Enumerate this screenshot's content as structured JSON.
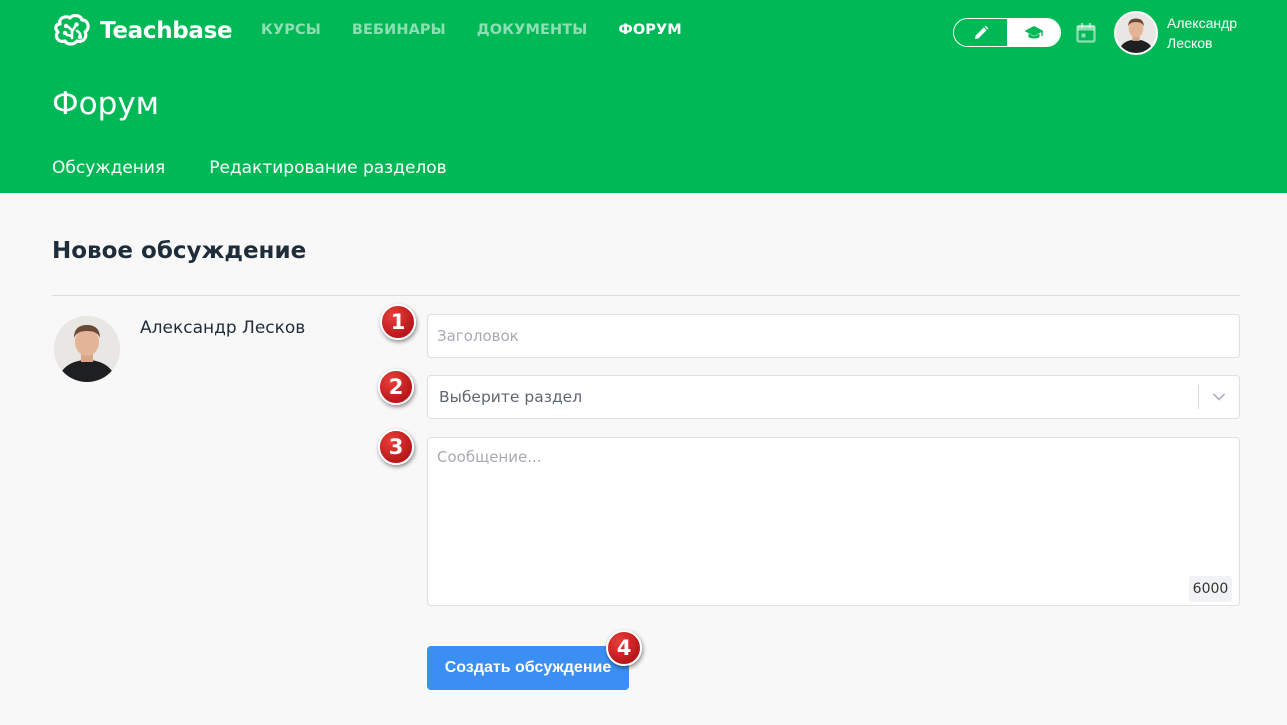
{
  "app": {
    "logo_text": "Teachbase",
    "brand_color": "#00b956",
    "accent_color": "#3b8ff3"
  },
  "nav": {
    "items": [
      {
        "label": "КУРСЫ",
        "active": false
      },
      {
        "label": "ВЕБИНАРЫ",
        "active": false
      },
      {
        "label": "ДОКУМЕНТЫ",
        "active": false
      },
      {
        "label": "ФОРУМ",
        "active": true
      }
    ]
  },
  "header": {
    "mode_icons": [
      "pencil-icon",
      "graduation-cap-icon"
    ],
    "calendar_icon": "calendar-icon",
    "user_name": "Александр Лесков"
  },
  "page": {
    "title": "Форум",
    "tabs": [
      {
        "label": "Обсуждения"
      },
      {
        "label": "Редактирование разделов"
      }
    ]
  },
  "form": {
    "title": "Новое обсуждение",
    "author_name": "Александр Лесков",
    "title_placeholder": "Заголовок",
    "title_value": "",
    "section_placeholder": "Выберите раздел",
    "message_placeholder": "Сообщение...",
    "message_value": "",
    "char_counter": "6000",
    "submit_label": "Создать обсуждение"
  },
  "markers": [
    "1",
    "2",
    "3",
    "4"
  ]
}
